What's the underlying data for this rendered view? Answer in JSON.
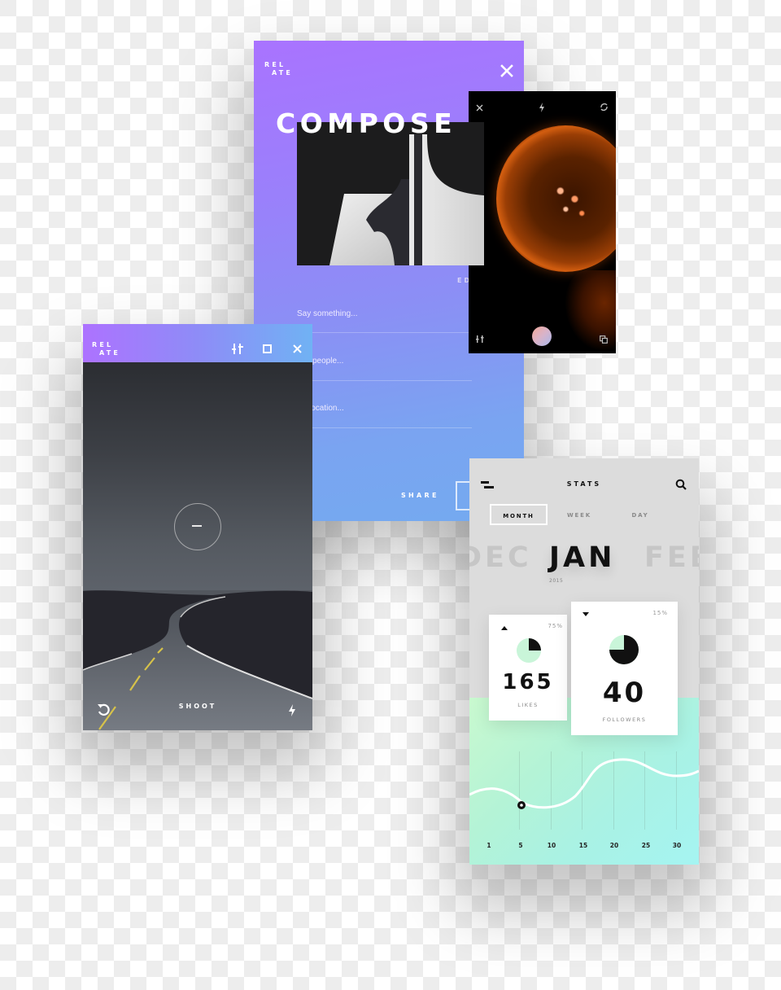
{
  "compose_screen": {
    "logo_line1": "REL",
    "logo_line2": "ATE",
    "close_icon": "close-icon",
    "title": "COMPOSE",
    "edit_label": "ED",
    "fields": [
      {
        "placeholder": "Say something..."
      },
      {
        "placeholder": "people..."
      },
      {
        "placeholder": "location..."
      }
    ],
    "share_label": "SHARE"
  },
  "jelly_camera": {
    "icons": [
      "close-icon",
      "flash-icon",
      "rotate-camera-icon",
      "adjust-icon",
      "shutter-button",
      "gallery-icon"
    ]
  },
  "shoot_screen": {
    "logo_line1": "REL",
    "logo_line2": "ATE",
    "header_icons": [
      "adjust-icon",
      "square-icon",
      "close-icon"
    ],
    "focus_symbol": "minus",
    "shoot_label": "SHOOT",
    "bottom_icons": [
      "undo-icon",
      "flash-icon"
    ]
  },
  "stats_screen": {
    "title": "STATS",
    "tabs": [
      {
        "label": "MONTH",
        "active": true
      },
      {
        "label": "WEEK",
        "active": false
      },
      {
        "label": "DAY",
        "active": false
      }
    ],
    "months": {
      "prev": "DEC",
      "current": "JAN",
      "next": "FEB"
    },
    "year": "2015",
    "cards": {
      "likes": {
        "value": "165",
        "label": "LIKES",
        "percent": "75%",
        "trend": "up",
        "pie_fraction": 0.25
      },
      "followers": {
        "value": "40",
        "label": "FOLLOWERS",
        "percent": "15%",
        "trend": "down",
        "pie_fraction": 0.75
      }
    },
    "chart": {
      "x_ticks": [
        "1",
        "5",
        "10",
        "15",
        "20",
        "25",
        "30"
      ],
      "selected_day": "5"
    },
    "colors": {
      "accent": "#111111",
      "pie_fill": "#c9f5d9",
      "chart_bg_start": "#c9f9cf",
      "chart_bg_end": "#a5f4f2"
    }
  },
  "colors": {
    "purple": "#a973ff",
    "blue": "#74aaf0"
  }
}
